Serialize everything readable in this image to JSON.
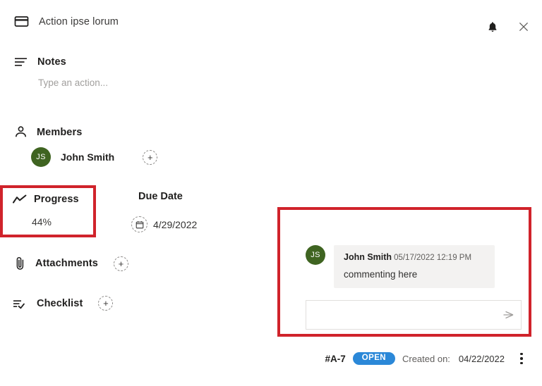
{
  "header": {
    "title": "Action ipse lorum",
    "card_icon": "card-icon",
    "bell_icon": "bell-icon",
    "close_icon": "close-icon"
  },
  "notes": {
    "label": "Notes",
    "icon": "notes-lines-icon",
    "placeholder": "Type an action...",
    "value": ""
  },
  "members": {
    "label": "Members",
    "icon": "person-icon",
    "list": [
      {
        "initials": "JS",
        "name": "John Smith",
        "avatar_color": "#3f6421"
      }
    ],
    "add_label": "+"
  },
  "progress": {
    "label": "Progress",
    "icon": "trend-line-icon",
    "value": "44%",
    "highlight_color": "#d0232b"
  },
  "due_date": {
    "label": "Due Date",
    "icon": "calendar-icon",
    "value": "4/29/2022"
  },
  "attachments": {
    "label": "Attachments",
    "icon": "paperclip-icon",
    "add_label": "+"
  },
  "checklist": {
    "label": "Checklist",
    "icon": "checklist-icon",
    "add_label": "+"
  },
  "comments": {
    "highlight_color": "#d0232b",
    "items": [
      {
        "initials": "JS",
        "avatar_color": "#3f6421",
        "author": "John Smith",
        "timestamp": "05/17/2022 12:19 PM",
        "text": "commenting here"
      }
    ],
    "input": {
      "placeholder": "",
      "value": "",
      "send_icon": "send-icon"
    }
  },
  "footer": {
    "ticket_id": "#A-7",
    "status": "OPEN",
    "status_color": "#2b88d8",
    "created_label": "Created on:",
    "created_value": "04/22/2022",
    "more_icon": "kebab-menu-icon"
  }
}
